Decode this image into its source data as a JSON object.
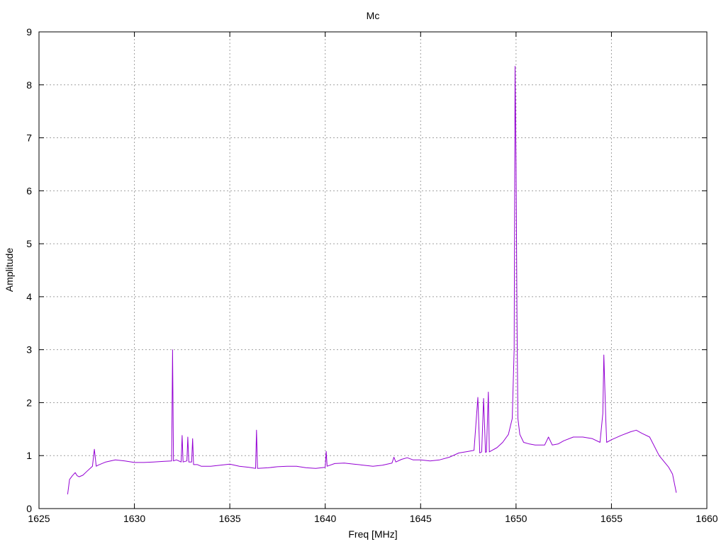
{
  "chart_data": {
    "type": "line",
    "title": "Mc",
    "xlabel": "Freq [MHz]",
    "ylabel": "Amplitude",
    "xlim": [
      1625,
      1660
    ],
    "ylim": [
      0,
      9
    ],
    "xticks": [
      1625,
      1630,
      1635,
      1640,
      1645,
      1650,
      1655,
      1660
    ],
    "yticks": [
      0,
      1,
      2,
      3,
      4,
      5,
      6,
      7,
      8,
      9
    ],
    "grid": true,
    "line_color": "#9400d3",
    "series": [
      {
        "x": [
          1626.5,
          1626.6,
          1626.75,
          1626.9,
          1627.0,
          1627.1,
          1627.3,
          1627.5,
          1627.8,
          1627.9,
          1628.0,
          1628.1,
          1628.5,
          1629.0,
          1629.5,
          1630.0,
          1630.5,
          1631.0,
          1631.5,
          1631.95,
          1632.0,
          1632.05,
          1632.2,
          1632.45,
          1632.5,
          1632.55,
          1632.75,
          1632.8,
          1632.85,
          1633.0,
          1633.05,
          1633.1,
          1633.3,
          1633.5,
          1634.0,
          1634.5,
          1635.0,
          1635.5,
          1636.0,
          1636.35,
          1636.4,
          1636.45,
          1637.0,
          1637.5,
          1638.0,
          1638.5,
          1639.0,
          1639.5,
          1640.0,
          1640.05,
          1640.1,
          1640.5,
          1641.0,
          1641.5,
          1642.0,
          1642.5,
          1643.0,
          1643.5,
          1643.6,
          1643.7,
          1644.0,
          1644.3,
          1644.6,
          1645.0,
          1645.5,
          1646.0,
          1646.5,
          1647.0,
          1647.5,
          1647.8,
          1648.0,
          1648.1,
          1648.2,
          1648.3,
          1648.4,
          1648.45,
          1648.55,
          1648.6,
          1648.65,
          1648.75,
          1649.0,
          1649.3,
          1649.6,
          1649.8,
          1649.9,
          1649.95,
          1650.0,
          1650.05,
          1650.1,
          1650.2,
          1650.4,
          1650.7,
          1651.0,
          1651.5,
          1651.7,
          1651.9,
          1652.2,
          1652.5,
          1653.0,
          1653.5,
          1654.0,
          1654.4,
          1654.55,
          1654.6,
          1654.7,
          1654.75,
          1655.0,
          1655.5,
          1656.0,
          1656.3,
          1656.6,
          1657.0,
          1657.5,
          1658.0,
          1658.2,
          1658.4
        ],
        "y": [
          0.27,
          0.55,
          0.62,
          0.68,
          0.62,
          0.6,
          0.63,
          0.7,
          0.8,
          1.12,
          0.8,
          0.82,
          0.88,
          0.92,
          0.9,
          0.87,
          0.87,
          0.88,
          0.89,
          0.9,
          3.0,
          0.9,
          0.92,
          0.88,
          1.38,
          0.88,
          0.9,
          1.35,
          0.88,
          0.88,
          1.32,
          0.83,
          0.83,
          0.8,
          0.8,
          0.82,
          0.84,
          0.8,
          0.78,
          0.76,
          1.48,
          0.76,
          0.77,
          0.79,
          0.8,
          0.8,
          0.77,
          0.76,
          0.78,
          1.08,
          0.8,
          0.85,
          0.86,
          0.84,
          0.82,
          0.8,
          0.82,
          0.86,
          0.97,
          0.88,
          0.93,
          0.96,
          0.92,
          0.92,
          0.9,
          0.92,
          0.97,
          1.05,
          1.08,
          1.1,
          2.1,
          1.05,
          1.07,
          2.08,
          1.06,
          1.07,
          2.2,
          1.07,
          1.08,
          1.1,
          1.15,
          1.25,
          1.4,
          1.7,
          3.0,
          8.35,
          6.5,
          3.6,
          1.7,
          1.4,
          1.25,
          1.22,
          1.2,
          1.2,
          1.35,
          1.2,
          1.22,
          1.28,
          1.35,
          1.35,
          1.32,
          1.25,
          1.8,
          2.9,
          1.7,
          1.25,
          1.3,
          1.38,
          1.45,
          1.48,
          1.42,
          1.35,
          1.0,
          0.78,
          0.65,
          0.3
        ]
      }
    ]
  }
}
